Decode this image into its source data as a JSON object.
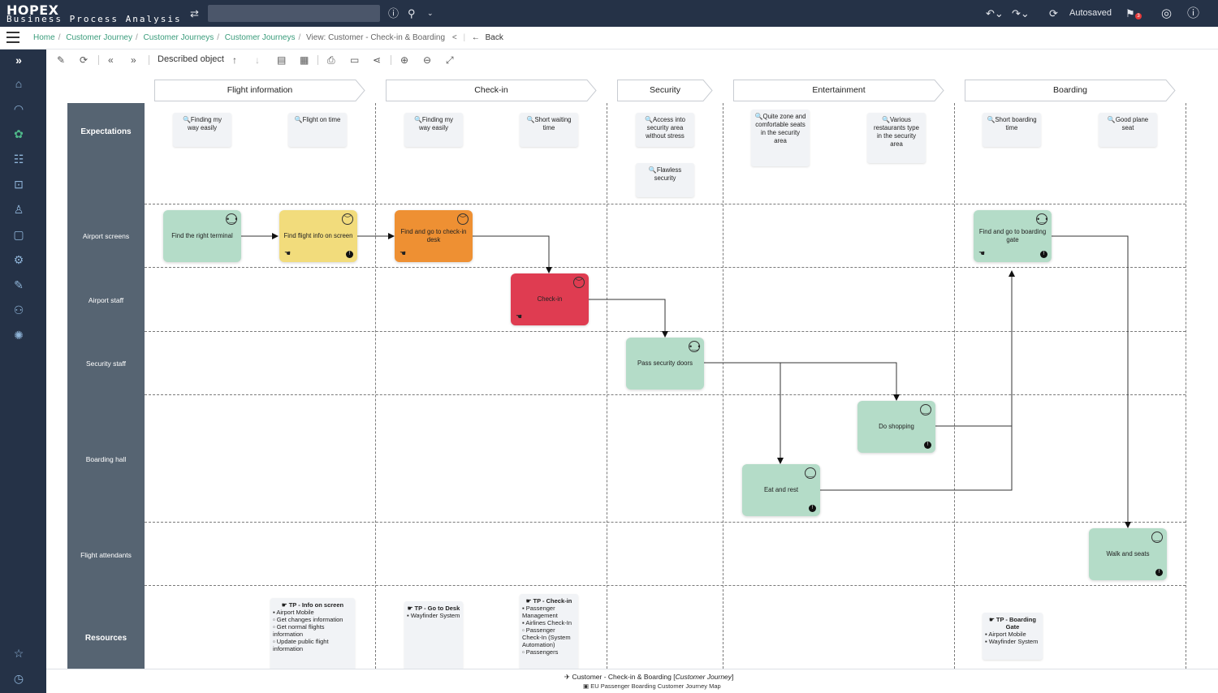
{
  "app": {
    "logo_name": "HOPEX",
    "logo_sub": "Business Process Analysis",
    "autosaved": "Autosaved",
    "notif_count": "3"
  },
  "breadcrumb": {
    "items": [
      "Home",
      "Customer Journey",
      "Customer Journeys",
      "Customer Journeys"
    ],
    "view": "View: Customer - Check-in & Boarding",
    "back": "Back"
  },
  "toolbar": {
    "described": "Described object"
  },
  "phases": [
    "Flight information",
    "Check-in",
    "Security",
    "Entertainment",
    "Boarding"
  ],
  "lanes": [
    "Expectations",
    "Airport screens",
    "Airport staff",
    "Security staff",
    "Boarding hall",
    "Flight attendants",
    "Resources"
  ],
  "expectations": [
    {
      "text": "Finding my way easily"
    },
    {
      "text": "Flight on time"
    },
    {
      "text": "Finding my way easily"
    },
    {
      "text": "Short waiting time"
    },
    {
      "text": "Access into security area without stress"
    },
    {
      "text": "Flawless security"
    },
    {
      "text": "Quite zone and comfortable seats in the security area"
    },
    {
      "text": "Various restaurants type in the security area"
    },
    {
      "text": "Short boarding time"
    },
    {
      "text": "Good plane seat"
    }
  ],
  "steps": [
    {
      "text": "Find the right terminal",
      "color": "#b4dcc8",
      "emotion": "neutral"
    },
    {
      "text": "Find flight info on screen",
      "color": "#f2dc7c",
      "emotion": "sad"
    },
    {
      "text": "Find and go to check-in desk",
      "color": "#ee9033",
      "emotion": "sad"
    },
    {
      "text": "Check-in",
      "color": "#df3c51",
      "emotion": "angry"
    },
    {
      "text": "Pass security doors",
      "color": "#b4dcc8",
      "emotion": "neutral"
    },
    {
      "text": "Do shopping",
      "color": "#b4dcc8",
      "emotion": "happy"
    },
    {
      "text": "Eat and rest",
      "color": "#b4dcc8",
      "emotion": "happy"
    },
    {
      "text": "Find and go to boarding gate",
      "color": "#b4dcc8",
      "emotion": "neutral"
    },
    {
      "text": "Walk and seats",
      "color": "#b4dcc8",
      "emotion": "happy"
    }
  ],
  "resources": [
    {
      "title": "TP - Info on screen",
      "items": [
        "Airport Mobile",
        "Get changes information",
        "Get normal flights information",
        "Update public flight information"
      ]
    },
    {
      "title": "TP - Go to Desk",
      "items": [
        "Wayfinder System"
      ]
    },
    {
      "title": "TP - Check-in",
      "items": [
        "Passenger Management",
        "Airlines Check-In",
        "Passenger Check-In (System Automation)",
        "Passengers"
      ]
    },
    {
      "title": "TP - Boarding Gate",
      "items": [
        "Airport Mobile",
        "Wayfinder System"
      ]
    }
  ],
  "footer": {
    "title": "Customer - Check-in & Boarding",
    "type": "Customer Journey",
    "subtitle": "EU Passenger Boarding Customer Journey Map"
  }
}
